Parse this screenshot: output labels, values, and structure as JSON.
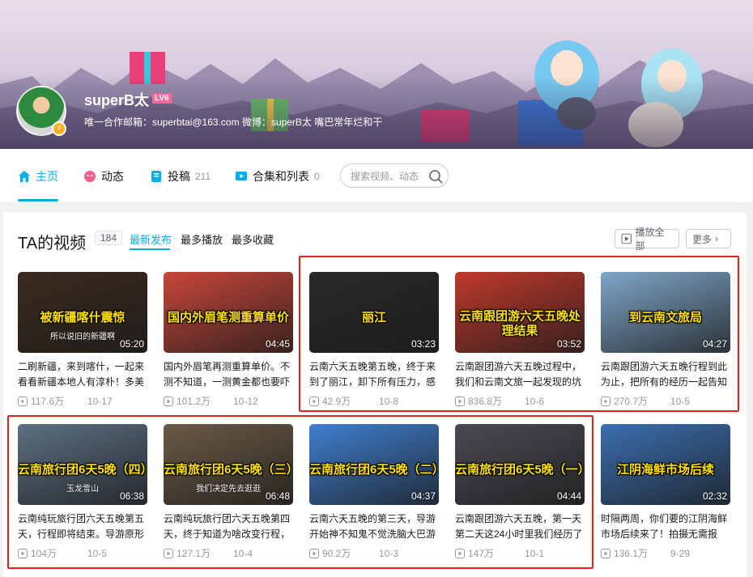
{
  "user": {
    "name": "superB太",
    "level": "LV6",
    "signature": "唯一合作邮箱：superbtai@163.com 微博：superB太 嘴巴常年烂和干"
  },
  "nav": {
    "items": [
      {
        "label": "主页",
        "count": ""
      },
      {
        "label": "动态",
        "count": ""
      },
      {
        "label": "投稿",
        "count": "211"
      },
      {
        "label": "合集和列表",
        "count": "0"
      }
    ],
    "search_placeholder": "搜索视频、动态"
  },
  "section": {
    "title": "TA的视频",
    "count": "184",
    "tabs": [
      "最新发布",
      "最多播放",
      "最多收藏"
    ],
    "play_all": "播放全部",
    "more": "更多"
  },
  "videos": [
    {
      "overlay": "被新疆喀什震惊",
      "sub": "所以说旧的新疆啊",
      "duration": "05:20",
      "title": "二刷新疆，来到喀什，一起来看看新疆本地人有淳朴！多美",
      "views": "117.6万",
      "date": "10-17",
      "bg": "#3b2a1e"
    },
    {
      "overlay": "国内外眉笔测重算单价",
      "sub": "",
      "duration": "04:45",
      "title": "国内外眉笔再测重算单价。不测不知道，一测黄金都也要吓",
      "views": "101.2万",
      "date": "10-12",
      "bg": "#c8463a"
    },
    {
      "overlay": "丽江",
      "sub": "",
      "duration": "03:23",
      "title": "云南六天五晚第五晚，终于来到了丽江，卸下所有压力，感",
      "views": "42.9万",
      "date": "10-8",
      "bg": "#2a2a2a"
    },
    {
      "overlay": "云南跟团游六天五晚处理结果",
      "sub": "",
      "duration": "03:52",
      "title": "云南跟团游六天五晚过程中，我们和云南文旅一起发现的坑",
      "views": "836.8万",
      "date": "10-6",
      "bg": "#c0392b"
    },
    {
      "overlay": "到云南文旅局",
      "sub": "",
      "duration": "04:27",
      "title": "云南跟团游六天五晚行程到此为止，把所有的经历一起告知",
      "views": "270.7万",
      "date": "10-5",
      "bg": "#7fa6c9"
    },
    {
      "overlay": "云南旅行团6天5晚（四）",
      "sub": "玉龙雪山",
      "duration": "06:38",
      "title": "云南纯玩旅行团六天五晚第五天，行程即将结束。导游原形",
      "views": "104万",
      "date": "10-5",
      "bg": "#5d7083"
    },
    {
      "overlay": "云南旅行团6天5晚（三）",
      "sub": "我们决定先去逛逛",
      "duration": "06:48",
      "title": "云南纯玩旅行团六天五晚第四天，终于知道为啥改变行程，",
      "views": "127.1万",
      "date": "10-4",
      "bg": "#6b5a45"
    },
    {
      "overlay": "云南旅行团6天5晚（二）",
      "sub": "",
      "duration": "04:37",
      "title": "云南六天五晚的第三天，导游开始神不知鬼不觉洗脑大巴游",
      "views": "90.2万",
      "date": "10-3",
      "bg": "#3f7fd0"
    },
    {
      "overlay": "云南旅行团6天5晚（一）",
      "sub": "",
      "duration": "04:44",
      "title": "云南跟团游六天五晚，第一天第二天这24小时里我们经历了",
      "views": "147万",
      "date": "10-1",
      "bg": "#4a4a52"
    },
    {
      "overlay": "江阴海鲜市场后续",
      "sub": "",
      "duration": "02:32",
      "title": "时隔两周，你们要的江阴海鲜市场后续来了！拍摄无需报",
      "views": "136.1万",
      "date": "9-29",
      "bg": "#3b6fb0"
    }
  ],
  "colors": {
    "accent": "#00aeec",
    "highlight": "#e0241b",
    "overlay_text": "#ffe100"
  }
}
